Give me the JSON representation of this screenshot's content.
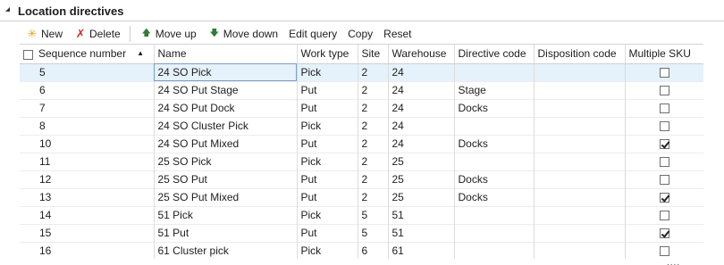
{
  "section": {
    "title": "Location directives"
  },
  "toolbar": {
    "new_label": "New",
    "delete_label": "Delete",
    "move_up_label": "Move up",
    "move_down_label": "Move down",
    "edit_query_label": "Edit query",
    "copy_label": "Copy",
    "reset_label": "Reset"
  },
  "grid": {
    "columns": [
      "Sequence number",
      "Name",
      "Work type",
      "Site",
      "Warehouse",
      "Directive code",
      "Disposition code",
      "Multiple SKU"
    ],
    "rows": [
      {
        "seq": "5",
        "name": "24 SO Pick",
        "work": "Pick",
        "site": "2",
        "wh": "24",
        "directive": "",
        "disposition": "",
        "multi": false
      },
      {
        "seq": "6",
        "name": "24 SO Put Stage",
        "work": "Put",
        "site": "2",
        "wh": "24",
        "directive": "Stage",
        "disposition": "",
        "multi": false
      },
      {
        "seq": "7",
        "name": "24 SO Put Dock",
        "work": "Put",
        "site": "2",
        "wh": "24",
        "directive": "Docks",
        "disposition": "",
        "multi": false
      },
      {
        "seq": "8",
        "name": "24 SO Cluster Pick",
        "work": "Pick",
        "site": "2",
        "wh": "24",
        "directive": "",
        "disposition": "",
        "multi": false
      },
      {
        "seq": "10",
        "name": "24 SO Put Mixed",
        "work": "Put",
        "site": "2",
        "wh": "24",
        "directive": "Docks",
        "disposition": "",
        "multi": true
      },
      {
        "seq": "11",
        "name": "25 SO Pick",
        "work": "Pick",
        "site": "2",
        "wh": "25",
        "directive": "",
        "disposition": "",
        "multi": false
      },
      {
        "seq": "12",
        "name": "25 SO Put",
        "work": "Put",
        "site": "2",
        "wh": "25",
        "directive": "Docks",
        "disposition": "",
        "multi": false
      },
      {
        "seq": "13",
        "name": "25 SO Put Mixed",
        "work": "Put",
        "site": "2",
        "wh": "25",
        "directive": "Docks",
        "disposition": "",
        "multi": true
      },
      {
        "seq": "14",
        "name": "51 Pick",
        "work": "Pick",
        "site": "5",
        "wh": "51",
        "directive": "",
        "disposition": "",
        "multi": false
      },
      {
        "seq": "15",
        "name": "51 Put",
        "work": "Put",
        "site": "5",
        "wh": "51",
        "directive": "",
        "disposition": "",
        "multi": true
      },
      {
        "seq": "16",
        "name": "61 Cluster pick",
        "work": "Pick",
        "site": "6",
        "wh": "61",
        "directive": "",
        "disposition": "",
        "multi": false
      }
    ]
  },
  "colors": {
    "selected_row": "#e5f1fb",
    "new_icon": "#e8a317",
    "delete_icon": "#d32f2f",
    "move_icon": "#2e7d32"
  },
  "icons": {
    "new": "star-icon",
    "delete": "x-icon",
    "move_up": "arrow-up-icon",
    "move_down": "arrow-down-icon"
  },
  "footer": {
    "more": "...."
  }
}
